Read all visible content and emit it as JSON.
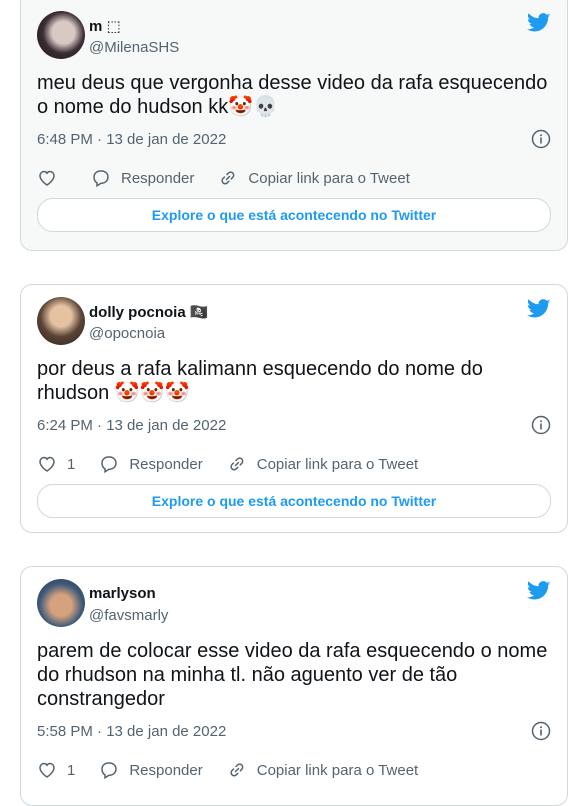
{
  "tweets": [
    {
      "name": "m ⬚",
      "handle": "@MilenaSHS",
      "text": "meu deus que vergonha desse video da rafa esquecendo\no nome do hudson kk🤡💀",
      "timestamp": "6:48 PM · 13 de jan de 2022",
      "like_count": "",
      "reply_label": "Responder",
      "copy_label": "Copiar link para o Tweet",
      "explore_label": "Explore o que está acontecendo no Twitter"
    },
    {
      "name": "dolly pocnoia 🏴‍☠️",
      "handle": "@opocnoia",
      "text": "por deus a rafa kalimann esquecendo do nome do\nrhudson 🤡🤡🤡",
      "timestamp": "6:24 PM · 13 de jan de 2022",
      "like_count": "1",
      "reply_label": "Responder",
      "copy_label": "Copiar link para o Tweet",
      "explore_label": "Explore o que está acontecendo no Twitter"
    },
    {
      "name": "marlyson",
      "handle": "@favsmarly",
      "text": "parem de colocar esse video da rafa esquecendo o nome\ndo rhudson na minha tl. não aguento ver de tão\nconstrangedor",
      "timestamp": "5:58 PM · 13 de jan de 2022",
      "like_count": "1",
      "reply_label": "Responder",
      "copy_label": "Copiar link para o Tweet"
    }
  ],
  "colors": {
    "twitter_blue": "#1d9bf0",
    "secondary_text": "#536471",
    "border": "#cfd9de"
  },
  "icons": [
    "twitter-bird-icon",
    "info-icon",
    "heart-icon",
    "reply-icon",
    "link-icon"
  ]
}
